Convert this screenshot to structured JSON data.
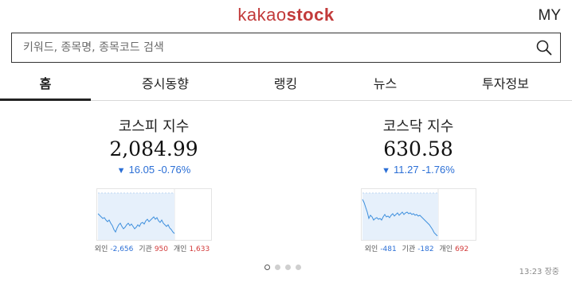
{
  "header": {
    "logo_part1": "kakao",
    "logo_part2": "stock",
    "my_label": "MY"
  },
  "search": {
    "placeholder": "키워드, 종목명, 종목코드 검색",
    "icon": "search-icon"
  },
  "tabs": [
    {
      "label": "홈",
      "active": true
    },
    {
      "label": "증시동향",
      "active": false
    },
    {
      "label": "랭킹",
      "active": false
    },
    {
      "label": "뉴스",
      "active": false
    },
    {
      "label": "투자정보",
      "active": false
    }
  ],
  "indices": [
    {
      "name": "코스피 지수",
      "value": "2,084.99",
      "direction_icon": "down-triangle-icon",
      "change": "16.05",
      "change_pct": "-0.76%",
      "investors": [
        {
          "label": "외인",
          "value": "-2,656"
        },
        {
          "label": "기관",
          "value": "950"
        },
        {
          "label": "개인",
          "value": "1,633"
        }
      ]
    },
    {
      "name": "코스닥 지수",
      "value": "630.58",
      "direction_icon": "down-triangle-icon",
      "change": "11.27",
      "change_pct": "-1.76%",
      "investors": [
        {
          "label": "외인",
          "value": "-481"
        },
        {
          "label": "기관",
          "value": "-182"
        },
        {
          "label": "개인",
          "value": "692"
        }
      ]
    }
  ],
  "colors": {
    "brand": "#c23a3a",
    "down": "#2b6fd6",
    "up": "#d23a3a",
    "chart_fill": "#e6f0fb",
    "chart_line": "#3d8fdd"
  },
  "pagination": {
    "count": 4,
    "active_index": 0
  },
  "market_status": "13:23 장중"
}
